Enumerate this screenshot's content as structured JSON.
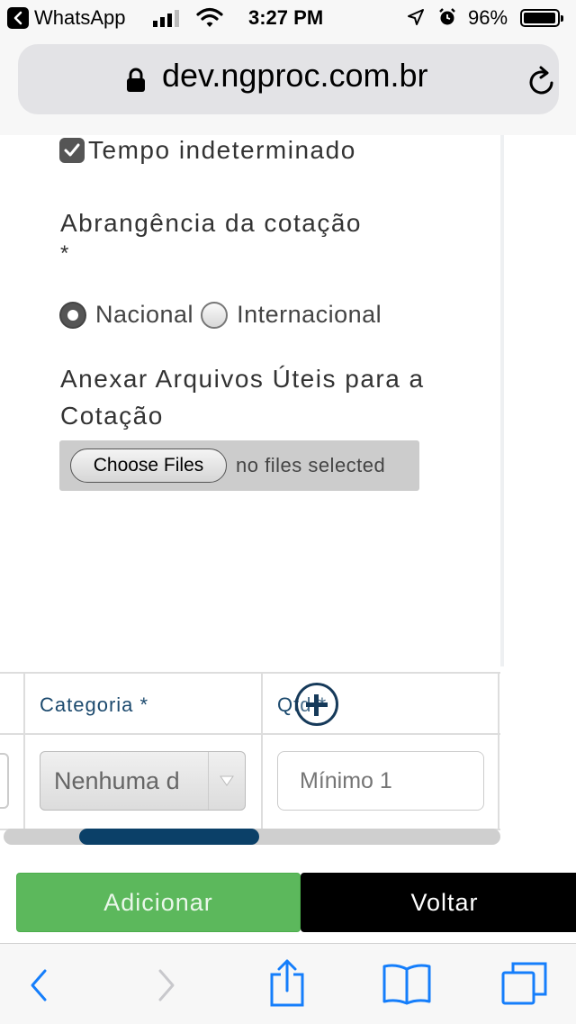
{
  "status_bar": {
    "back_app": "WhatsApp",
    "time": "3:27 PM",
    "battery_percent": "96%",
    "battery_level": 0.96
  },
  "browser": {
    "url": "dev.ngproc.com.br"
  },
  "form": {
    "checkbox_label": "Tempo indeterminado",
    "checkbox_checked": true,
    "scope_label": "Abrangência da cotação",
    "required_mark": "*",
    "scope_options": [
      "Nacional",
      "Internacional"
    ],
    "scope_selected": "Nacional",
    "attach_label": "Anexar Arquivos Úteis para a Cotação",
    "file_button": "Choose Files",
    "file_status": "no files selected"
  },
  "table": {
    "headers": [
      "Categoria *",
      "Qtd *"
    ],
    "category_select_value": "Nenhuma d",
    "qty_placeholder": "Mínimo 1"
  },
  "actions": {
    "add_label": "Adicionar",
    "back_label": "Voltar"
  },
  "toolbar": {
    "icons": [
      "back-icon",
      "forward-icon",
      "share-icon",
      "bookmarks-icon",
      "tabs-icon"
    ]
  },
  "colors": {
    "add_button": "#5cb85c",
    "back_button": "#000000",
    "header_text": "#1c4a6e",
    "scroll_thumb": "#0b4068",
    "ios_blue": "#157efb"
  }
}
